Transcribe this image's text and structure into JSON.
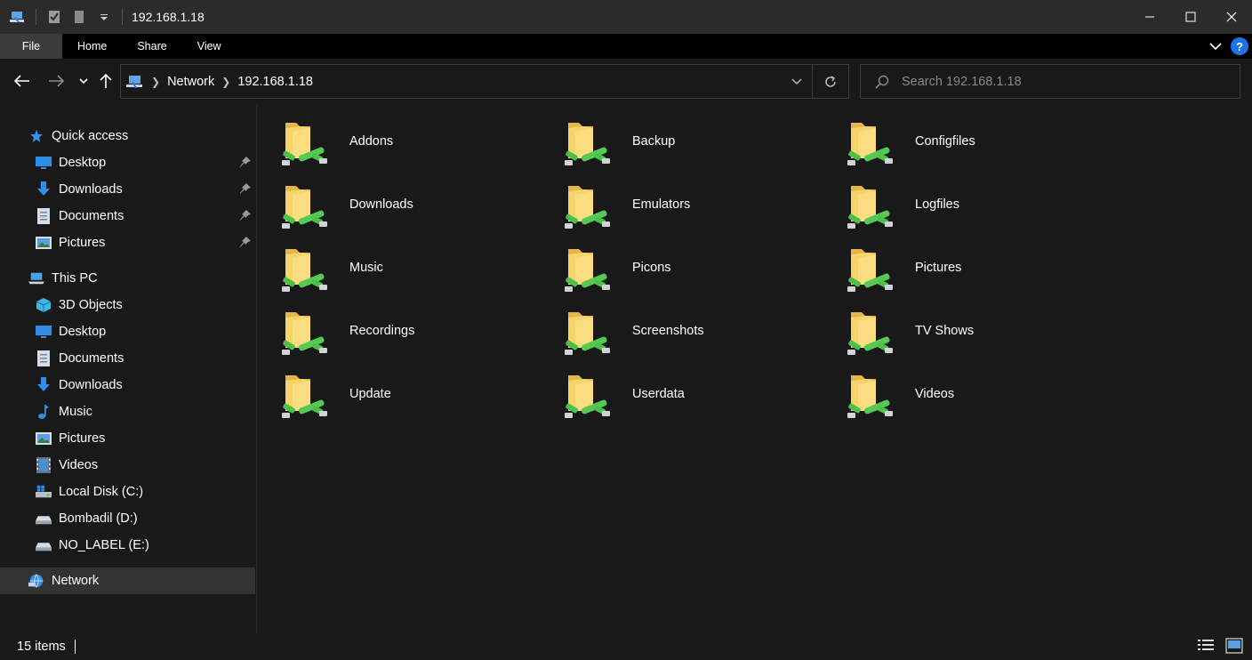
{
  "window": {
    "title": "192.168.1.18"
  },
  "ribbon": {
    "tabs": [
      "File",
      "Home",
      "Share",
      "View"
    ]
  },
  "address": {
    "crumbs": [
      "Network",
      "192.168.1.18"
    ]
  },
  "search": {
    "placeholder": "Search 192.168.1.18"
  },
  "sidebar": {
    "quick_access": {
      "label": "Quick access",
      "items": [
        {
          "label": "Desktop",
          "icon": "desktop-icon",
          "pinned": true
        },
        {
          "label": "Downloads",
          "icon": "downloads-icon",
          "pinned": true
        },
        {
          "label": "Documents",
          "icon": "documents-icon",
          "pinned": true
        },
        {
          "label": "Pictures",
          "icon": "pictures-icon",
          "pinned": true
        }
      ]
    },
    "this_pc": {
      "label": "This PC",
      "items": [
        {
          "label": "3D Objects",
          "icon": "3d-objects-icon"
        },
        {
          "label": "Desktop",
          "icon": "desktop-icon"
        },
        {
          "label": "Documents",
          "icon": "documents-icon"
        },
        {
          "label": "Downloads",
          "icon": "downloads-icon"
        },
        {
          "label": "Music",
          "icon": "music-icon"
        },
        {
          "label": "Pictures",
          "icon": "pictures-icon"
        },
        {
          "label": "Videos",
          "icon": "videos-icon"
        },
        {
          "label": "Local Disk (C:)",
          "icon": "local-disk-icon"
        },
        {
          "label": "Bombadil (D:)",
          "icon": "drive-icon"
        },
        {
          "label": "NO_LABEL (E:)",
          "icon": "drive-icon"
        }
      ]
    },
    "network": {
      "label": "Network",
      "selected": true
    }
  },
  "content": {
    "folders": [
      "Addons",
      "Backup",
      "Configfiles",
      "Downloads",
      "Emulators",
      "Logfiles",
      "Music",
      "Picons",
      "Pictures",
      "Recordings",
      "Screenshots",
      "TV Shows",
      "Update",
      "Userdata",
      "Videos"
    ]
  },
  "status": {
    "items": "15 items"
  },
  "colors": {
    "background": "#191919",
    "titlebar": "#2b2b2b",
    "selected": "#333333",
    "accent": "#1a73e8",
    "folder": "#f4cf5c",
    "share_pipe": "#4cc14a"
  }
}
